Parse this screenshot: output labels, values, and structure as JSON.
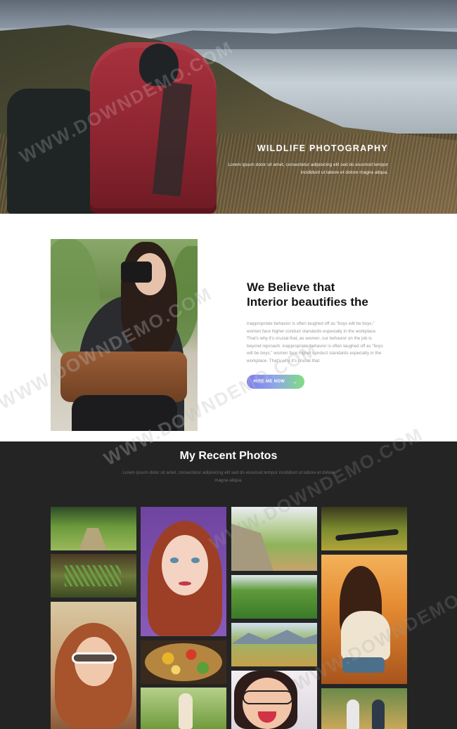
{
  "hero": {
    "title": "WILDLIFE PHOTOGRAPHY",
    "description": "Lorem ipsum dolor sit amet, consectetur adipisicing elit sed do eiusmod tempor incididunt ut labore et dolore magna aliqua."
  },
  "about": {
    "title_line1": "We Believe that",
    "title_line2": "Interior beautifies the",
    "body": "inappropriate behavior is often laughed off as \"boys will be boys,\" women face higher conduct standards especially in the workplace. That's why it's crucial that, as women, our behavior on the job is beyond reproach. inappropriate behavior is often laughed off as \"boys will be boys,\" women face higher conduct standards especially in the workplace. That's why it's crucial that.",
    "button_label": "HIRE ME NOW",
    "button_arrow": "→"
  },
  "gallery": {
    "title": "My Recent Photos",
    "description": "Lorem ipsum dolor sit amet, consectetur adipisicing elit sed do eiusmod tempor incididunt ut labore et dolore magna aliqua."
  },
  "watermark": "WWW.DOWNDEMO.COM",
  "colors": {
    "button_gradient_start": "#7a7bf0",
    "button_gradient_end": "#7fe07f",
    "gallery_background": "#242424"
  }
}
